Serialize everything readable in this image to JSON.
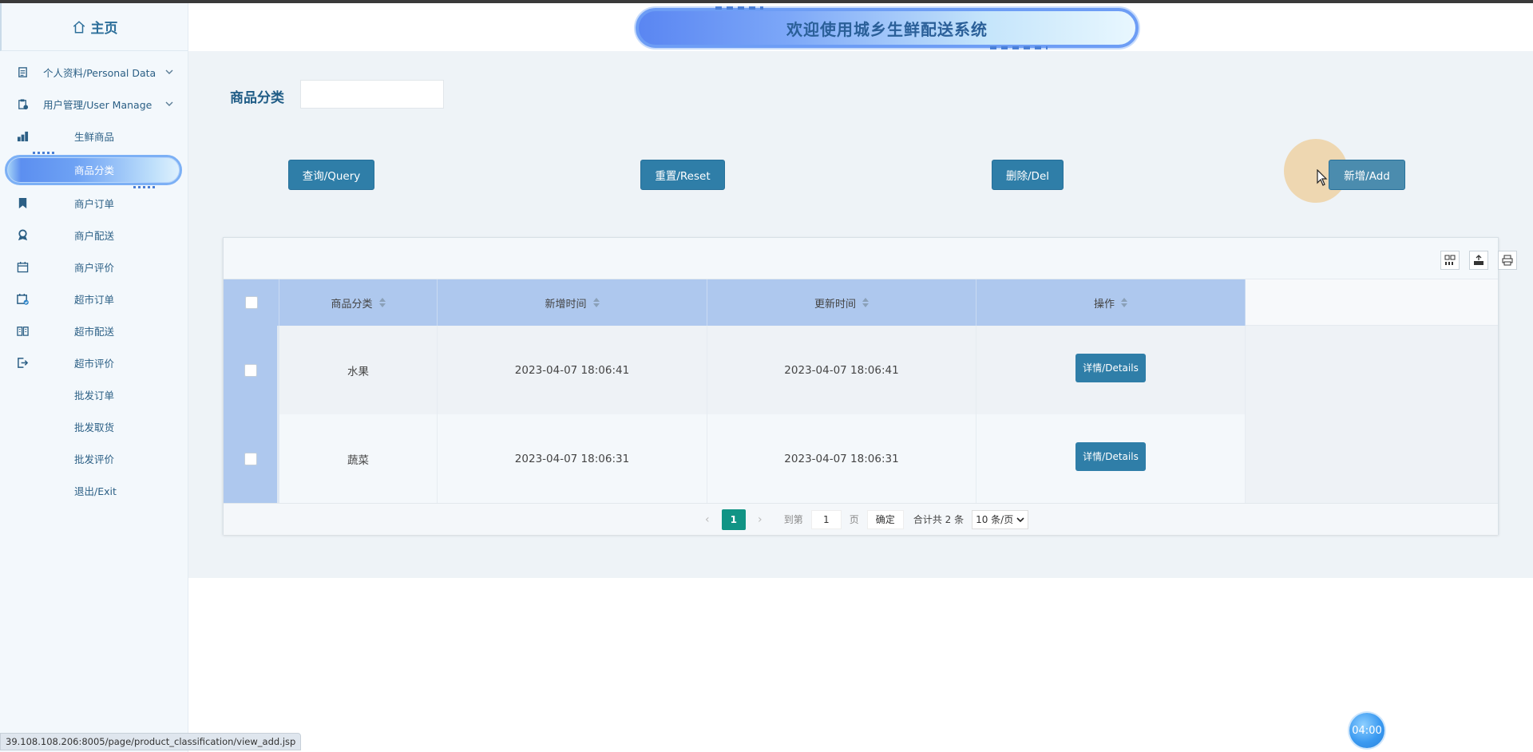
{
  "sidebar": {
    "home_label": "主页",
    "items": [
      {
        "label": "个人资料/Personal Data",
        "icon": "document-icon",
        "group": true
      },
      {
        "label": "用户管理/User Manage",
        "icon": "clipboard-user-icon",
        "group": true
      },
      {
        "label": "生鲜商品",
        "icon": "stats-icon"
      },
      {
        "label": "商品分类",
        "icon": "",
        "active": true
      },
      {
        "label": "商户订单",
        "icon": "bookmark-icon"
      },
      {
        "label": "商户配送",
        "icon": "award-icon"
      },
      {
        "label": "商户评价",
        "icon": "calendar-icon"
      },
      {
        "label": "超市订单",
        "icon": "calendar-check-icon"
      },
      {
        "label": "超市配送",
        "icon": "book-icon"
      },
      {
        "label": "超市评价",
        "icon": "exit-icon"
      },
      {
        "label": "批发订单",
        "icon": ""
      },
      {
        "label": "批发取货",
        "icon": ""
      },
      {
        "label": "批发评价",
        "icon": ""
      },
      {
        "label": "退出/Exit",
        "icon": ""
      }
    ]
  },
  "header": {
    "banner_title": "欢迎使用城乡生鲜配送系统"
  },
  "filter": {
    "label": "商品分类",
    "value": ""
  },
  "actions": {
    "query": "查询/Query",
    "reset": "重置/Reset",
    "delete": "删除/Del",
    "add": "新增/Add"
  },
  "table": {
    "columns": [
      "商品分类",
      "新增时间",
      "更新时间",
      "操作"
    ],
    "rows": [
      {
        "category": "水果",
        "created": "2023-04-07 18:06:41",
        "updated": "2023-04-07 18:06:41",
        "action": "详情/Details"
      },
      {
        "category": "蔬菜",
        "created": "2023-04-07 18:06:31",
        "updated": "2023-04-07 18:06:31",
        "action": "详情/Details"
      }
    ]
  },
  "pager": {
    "current": "1",
    "goto_label": "到第",
    "page_input": "1",
    "page_unit": "页",
    "confirm": "确定",
    "total": "合计共 2 条",
    "page_size": "10 条/页"
  },
  "status_url": "39.108.108.206:8005/page/product_classification/view_add.jsp",
  "timer": "04:00",
  "colors": {
    "primary_button": "#2f7ea8",
    "table_header": "#aec8ee",
    "page_active": "#119485",
    "title_text": "#1f5c86"
  }
}
